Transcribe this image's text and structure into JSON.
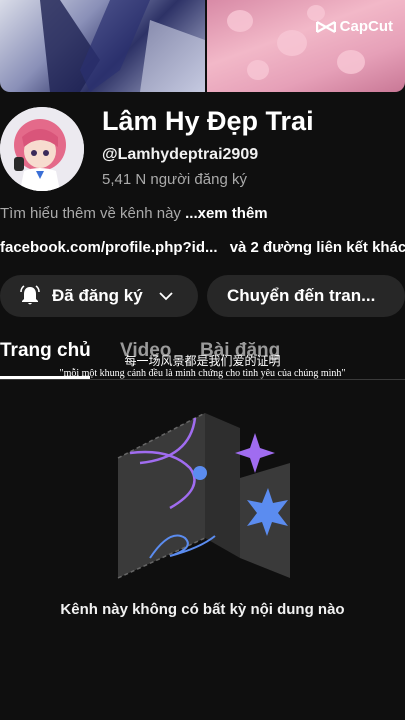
{
  "watermark": {
    "label": "CapCut",
    "icon": "capcut-logo-icon"
  },
  "channel": {
    "name": "Lâm Hy Đẹp Trai",
    "handle": "@Lamhydeptrai2909",
    "subscribers": "5,41 N người đăng ký",
    "about": "Tìm hiểu thêm về kênh này",
    "about_more": "...xem thêm",
    "link": "facebook.com/profile.php?id...",
    "links_more": "và 2 đường liên kết khác"
  },
  "actions": {
    "subscribed_label": "Đã đăng ký",
    "subscribed_icon": "bell-icon",
    "dropdown_icon": "chevron-down-icon",
    "goto_label": "Chuyển đến tran..."
  },
  "tabs": [
    {
      "label": "Trang chủ",
      "active": true
    },
    {
      "label": "Video",
      "active": false
    },
    {
      "label": "Bài đăng",
      "active": false
    }
  ],
  "subtitles": {
    "chinese": "每一场风景都是我们爱的证明",
    "vietnamese": "\"mỗi một khung cảnh đều là minh chứng cho tình yêu của chúng mình\""
  },
  "empty_state": {
    "message": "Kênh này không có bất kỳ nội dung nào"
  },
  "colors": {
    "background": "#0f0f0f",
    "button": "#272727",
    "muted_text": "#aaaaaa",
    "accent_purple": "#a06cf0",
    "accent_blue": "#5b8cf0"
  }
}
